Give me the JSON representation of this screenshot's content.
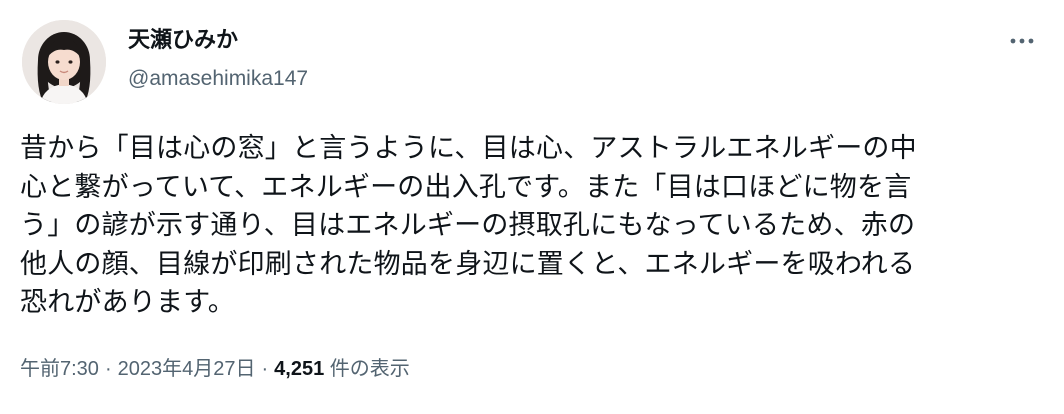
{
  "author": {
    "display_name": "天瀬ひみか",
    "handle": "@amasehimika147"
  },
  "tweet": {
    "lines": [
      "昔から「目は心の窓」と言うように、目は心、アストラルエネルギーの中",
      "心と繋がっていて、エネルギーの出入孔です。また「目は口ほどに物を言",
      "う」の諺が示す通り、目はエネルギーの摂取孔にもなっているため、赤の",
      "他人の顔、目線が印刷された物品を身辺に置くと、エネルギーを吸われる",
      "恐れがあります。"
    ]
  },
  "meta": {
    "time": "午前7:30",
    "separator": "·",
    "date": "2023年4月27日",
    "views_count": "4,251",
    "views_label": "件の表示"
  },
  "icons": {
    "more": "more-horizontal-icon"
  },
  "colors": {
    "text_primary": "#0f1419",
    "text_secondary": "#536471",
    "background": "#ffffff"
  }
}
